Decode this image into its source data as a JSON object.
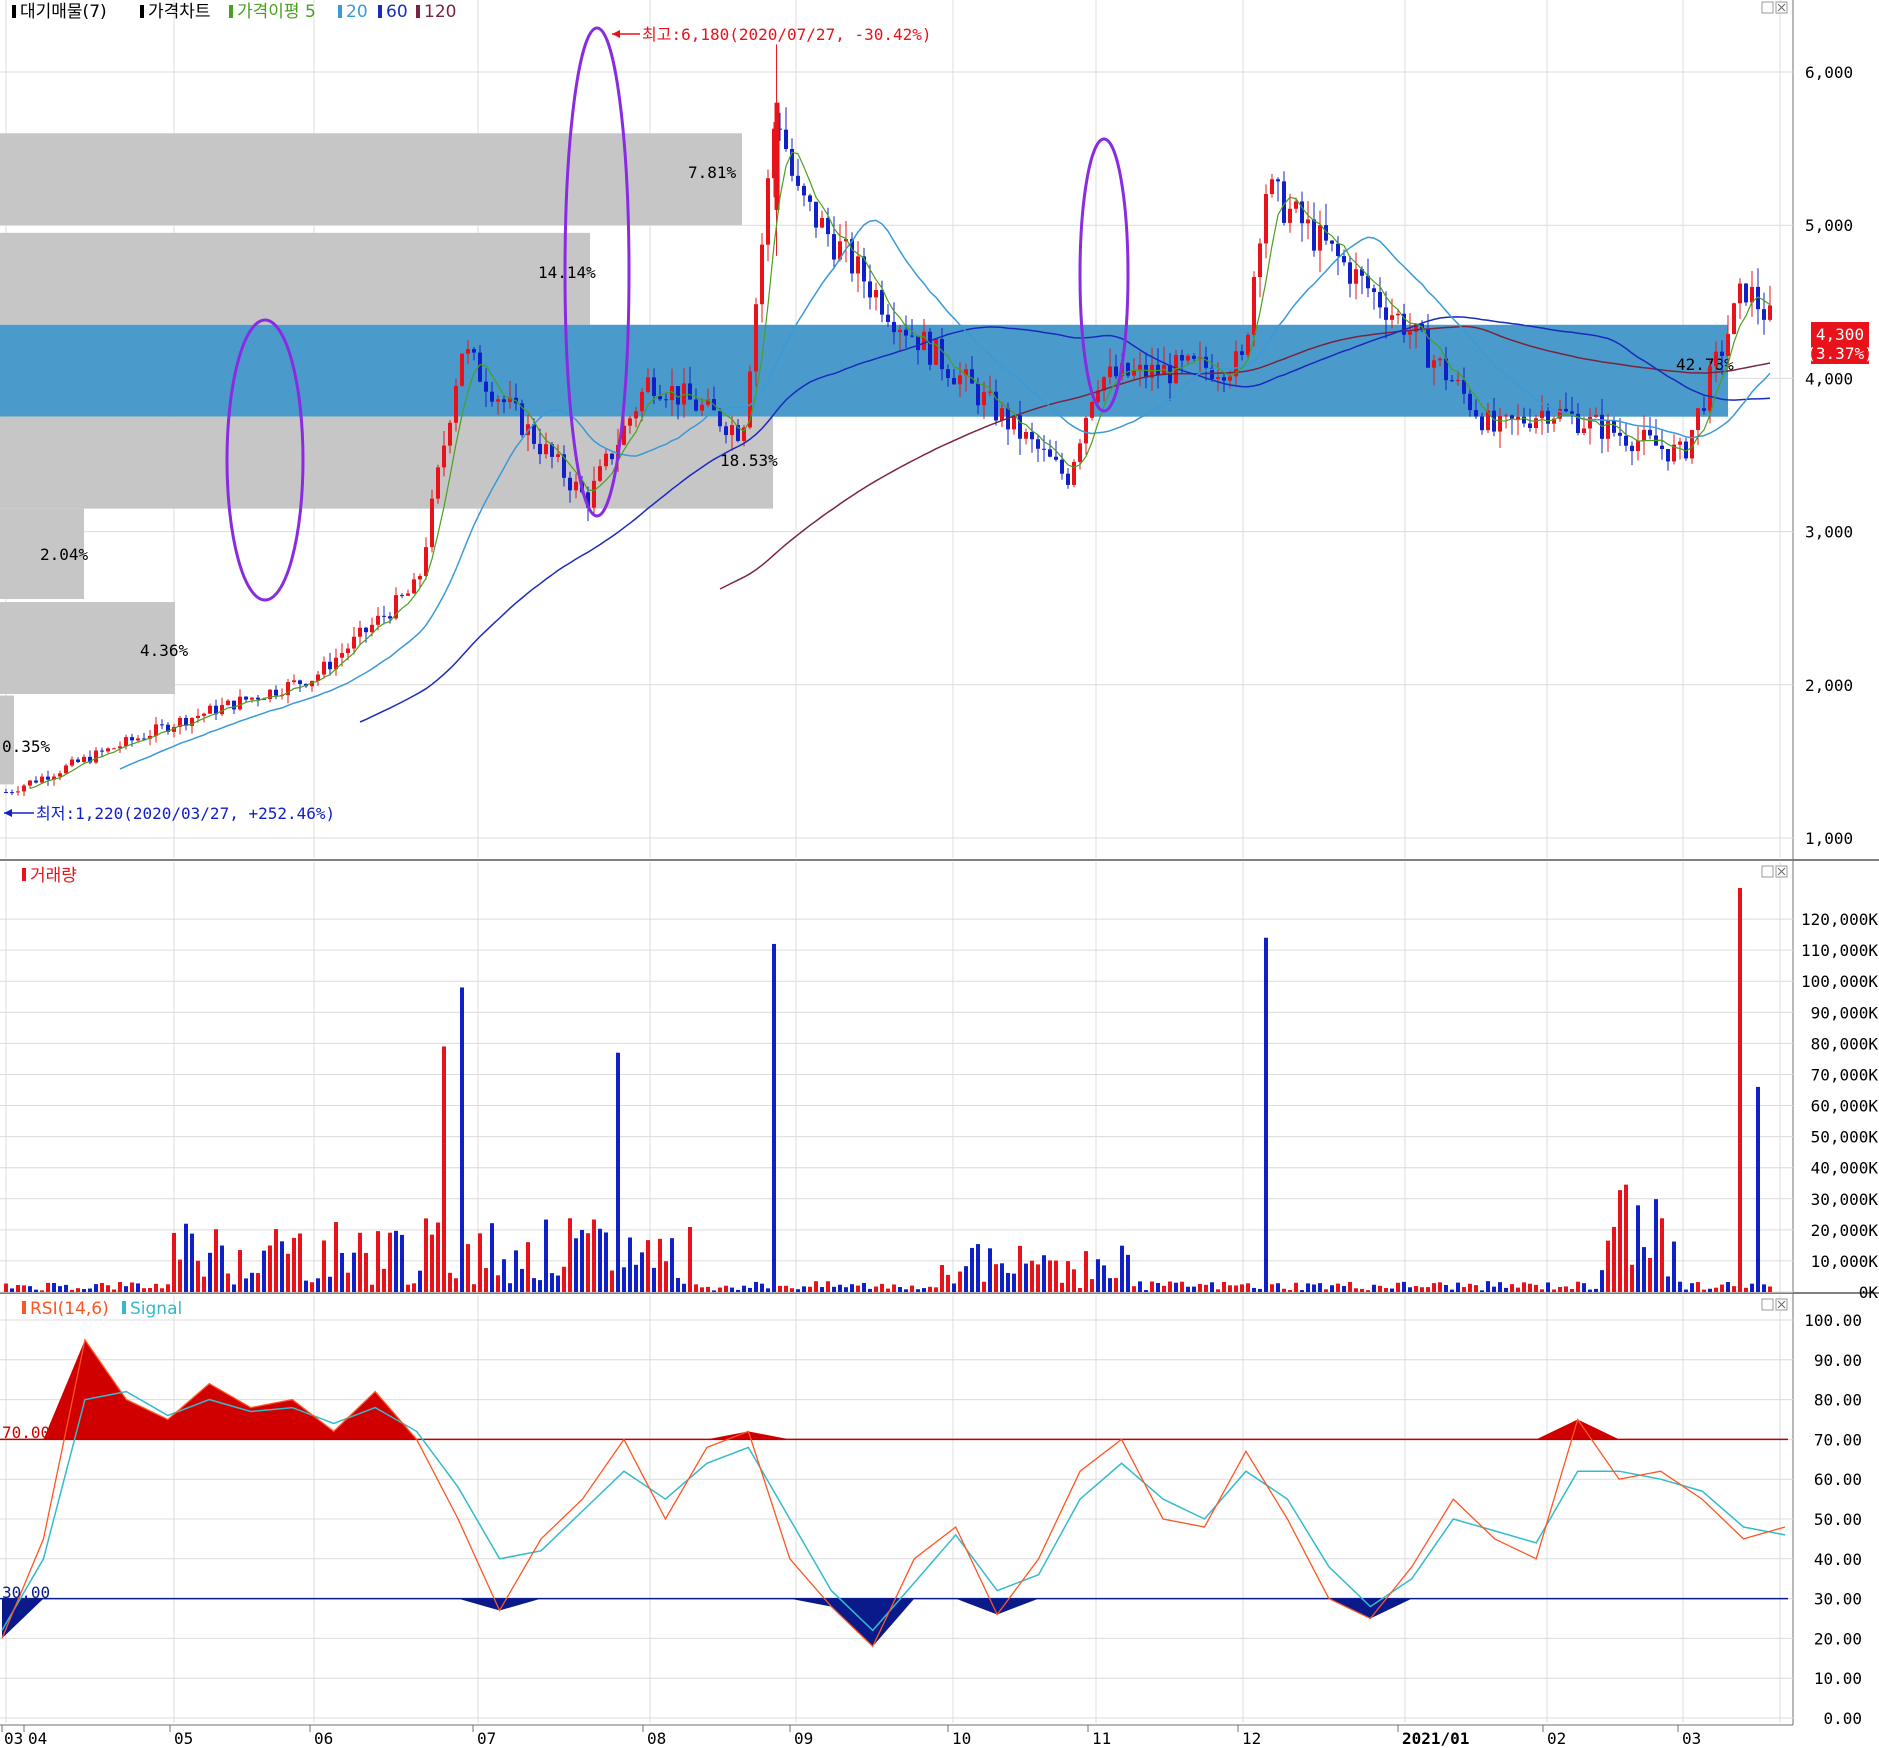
{
  "colors": {
    "up": "#e8131a",
    "down": "#1020c8",
    "ma5": "#4aa01e",
    "ma20": "#3a9ad8",
    "ma60": "#1a2ac0",
    "ma120": "#7a2440",
    "zone": "#c6c6c6",
    "highlight": "#4a9bcb",
    "ellipse": "#8a2be2",
    "rsi": "#ff5522",
    "signal": "#33bbcc",
    "overbought_fill": "#d00000",
    "oversold_fill": "#0a1a8a",
    "grid": "#dcdcdc"
  },
  "panes": {
    "price": {
      "legend": [
        {
          "text": "대기매물(7)",
          "color": "#000000"
        },
        {
          "text": "가격차트",
          "color": "#000000"
        },
        {
          "text": "가격이평 5",
          "color": "#4aa01e"
        },
        {
          "text": "20",
          "color": "#3a9ad8"
        },
        {
          "text": "60",
          "color": "#1a2ac0"
        },
        {
          "text": "120",
          "color": "#7a2440"
        }
      ],
      "y_ticks": [
        "1,000",
        "2,000",
        "3,000",
        "4,000",
        "5,000",
        "6,000"
      ],
      "annotations": {
        "high": "최고:6,180(2020/07/27, -30.42%)",
        "low": "최저:1,220(2020/03/27, +252.46%)"
      },
      "current_price": "4,300",
      "current_change": "(3.37%)",
      "zone_labels": [
        "0.35%",
        "4.36%",
        "2.04%",
        "18.53%",
        "14.14%",
        "7.81%",
        "42.78%"
      ]
    },
    "volume": {
      "legend": [
        {
          "text": "거래량",
          "color": "#e8131a"
        }
      ],
      "y_ticks": [
        "0K",
        "10,000K",
        "20,000K",
        "30,000K",
        "40,000K",
        "50,000K",
        "60,000K",
        "70,000K",
        "80,000K",
        "90,000K",
        "100,000K",
        "110,000K",
        "120,000K"
      ]
    },
    "rsi": {
      "legend": [
        {
          "text": "RSI(14,6)",
          "color": "#ff5522"
        },
        {
          "text": "Signal",
          "color": "#33bbcc"
        }
      ],
      "y_ticks": [
        "0.00",
        "10.00",
        "20.00",
        "30.00",
        "40.00",
        "50.00",
        "60.00",
        "70.00",
        "80.00",
        "90.00",
        "100.00"
      ],
      "upper_label": "70.00",
      "lower_label": "30.00"
    }
  },
  "x_axis": {
    "labels": [
      "03",
      "04",
      "05",
      "06",
      "07",
      "08",
      "09",
      "10",
      "11",
      "12",
      "2021/01",
      "02",
      "03"
    ]
  },
  "chart_data": [
    {
      "type": "candlestick",
      "title": "가격차트",
      "ylim": [
        1000,
        6300
      ],
      "x": [
        "2020-03",
        "2020-04",
        "2020-05",
        "2020-06",
        "2020-07",
        "2020-08",
        "2020-09",
        "2020-10",
        "2020-11",
        "2020-12",
        "2021-01",
        "2021-02",
        "2021-03"
      ],
      "key_points": [
        {
          "date": "2020-03-27",
          "label": "low",
          "value": 1220
        },
        {
          "date": "2020-07-27",
          "label": "high",
          "value": 6180
        },
        {
          "date": "2021-03",
          "label": "last",
          "value": 4300
        }
      ],
      "approx_close_path": [
        {
          "x": "2020-03",
          "y": 1300
        },
        {
          "x": "2020-04",
          "y": 1750
        },
        {
          "x": "2020-05-01",
          "y": 2050
        },
        {
          "x": "2020-05-20",
          "y": 2650
        },
        {
          "x": "2020-05-28",
          "y": 4200
        },
        {
          "x": "2020-06",
          "y": 4050
        },
        {
          "x": "2020-06-20",
          "y": 3200
        },
        {
          "x": "2020-07",
          "y": 4000
        },
        {
          "x": "2020-07-20",
          "y": 3650
        },
        {
          "x": "2020-07-27",
          "y": 5800
        },
        {
          "x": "2020-08",
          "y": 5200
        },
        {
          "x": "2020-08-20",
          "y": 4400
        },
        {
          "x": "2020-09",
          "y": 4050
        },
        {
          "x": "2020-09-25",
          "y": 3350
        },
        {
          "x": "2020-10",
          "y": 4000
        },
        {
          "x": "2020-11",
          "y": 4100
        },
        {
          "x": "2020-11-05",
          "y": 5250
        },
        {
          "x": "2020-12",
          "y": 4350
        },
        {
          "x": "2020-12-20",
          "y": 3650
        },
        {
          "x": "2021-01",
          "y": 3800
        },
        {
          "x": "2021-02",
          "y": 3500
        },
        {
          "x": "2021-02-20",
          "y": 4600
        },
        {
          "x": "2021-03",
          "y": 4300
        }
      ],
      "supply_zones": [
        {
          "from": 5000,
          "to": 5600,
          "label": "7.81%"
        },
        {
          "from": 4350,
          "to": 4950,
          "label": "14.14%"
        },
        {
          "from": 3750,
          "to": 4350,
          "label": "42.78%",
          "highlight": true
        },
        {
          "from": 3150,
          "to": 3750,
          "label": "18.53%"
        },
        {
          "from": 2560,
          "to": 3150,
          "label": "2.04%"
        },
        {
          "from": 1940,
          "to": 2540,
          "label": "4.36%"
        },
        {
          "from": 1350,
          "to": 1930,
          "label": "0.35%"
        }
      ],
      "series": [
        {
          "name": "5"
        },
        {
          "name": "20"
        },
        {
          "name": "60"
        },
        {
          "name": "120"
        }
      ]
    },
    {
      "type": "bar",
      "title": "거래량",
      "ylim": [
        0,
        130000
      ],
      "unit": "K",
      "spikes": [
        {
          "x": "2020-05-25",
          "value": 79000
        },
        {
          "x": "2020-05-28",
          "value": 98000
        },
        {
          "x": "2020-06-25",
          "value": 77000
        },
        {
          "x": "2020-07-27",
          "value": 112000
        },
        {
          "x": "2020-11-05",
          "value": 114000
        },
        {
          "x": "2021-02-18",
          "value": 130000
        },
        {
          "x": "2021-02-25",
          "value": 66000
        }
      ]
    },
    {
      "type": "line",
      "title": "RSI(14,6)",
      "ylim": [
        0,
        100
      ],
      "thresholds": [
        70,
        30
      ],
      "series": [
        {
          "name": "RSI(14,6)",
          "values": [
            20,
            45,
            95,
            80,
            75,
            84,
            78,
            80,
            72,
            82,
            70,
            50,
            27,
            45,
            55,
            70,
            50,
            68,
            72,
            40,
            28,
            18,
            40,
            48,
            26,
            40,
            62,
            70,
            50,
            48,
            67,
            50,
            30,
            25,
            38,
            55,
            45,
            40,
            75,
            60,
            62,
            55,
            45,
            48
          ]
        },
        {
          "name": "Signal",
          "values": [
            22,
            40,
            80,
            82,
            76,
            80,
            77,
            78,
            74,
            78,
            72,
            58,
            40,
            42,
            52,
            62,
            55,
            64,
            68,
            50,
            32,
            22,
            34,
            46,
            32,
            36,
            55,
            64,
            55,
            50,
            62,
            55,
            38,
            28,
            35,
            50,
            47,
            44,
            62,
            62,
            60,
            57,
            48,
            46
          ]
        }
      ]
    }
  ]
}
